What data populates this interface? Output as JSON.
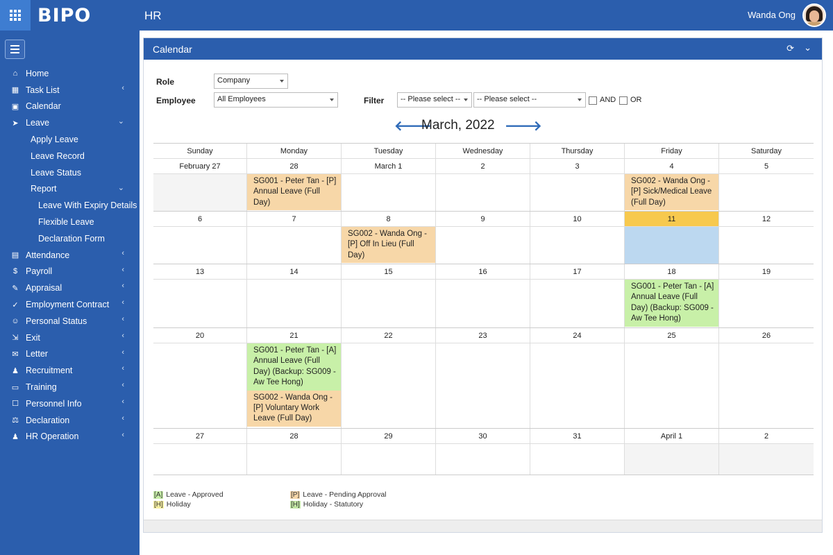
{
  "header": {
    "logo": "BIPO",
    "module": "HR",
    "user_name": "Wanda Ong",
    "colors": {
      "bar": "#2b5ead",
      "apps_button": "#3e7dd1"
    }
  },
  "sidebar": {
    "items": [
      {
        "label": "Home",
        "icon": "home-icon",
        "chevron": ""
      },
      {
        "label": "Task List",
        "icon": "task-list-icon",
        "chevron": "‹"
      },
      {
        "label": "Calendar",
        "icon": "calendar-icon",
        "chevron": ""
      },
      {
        "label": "Leave",
        "icon": "leave-icon",
        "chevron": "⌄"
      },
      {
        "label": "Apply Leave",
        "icon": "",
        "chevron": ""
      },
      {
        "label": "Leave Record",
        "icon": "",
        "chevron": ""
      },
      {
        "label": "Leave Status",
        "icon": "",
        "chevron": ""
      },
      {
        "label": "Report",
        "icon": "",
        "chevron": "⌄"
      },
      {
        "label": "Leave With Expiry Details",
        "icon": "",
        "chevron": ""
      },
      {
        "label": "Flexible Leave",
        "icon": "",
        "chevron": ""
      },
      {
        "label": "Declaration Form",
        "icon": "",
        "chevron": ""
      },
      {
        "label": "Attendance",
        "icon": "attendance-icon",
        "chevron": "‹"
      },
      {
        "label": "Payroll",
        "icon": "payroll-icon",
        "chevron": "‹"
      },
      {
        "label": "Appraisal",
        "icon": "appraisal-icon",
        "chevron": "‹"
      },
      {
        "label": "Employment Contract",
        "icon": "contract-icon",
        "chevron": "‹"
      },
      {
        "label": "Personal Status",
        "icon": "personal-status-icon",
        "chevron": "‹"
      },
      {
        "label": "Exit",
        "icon": "exit-icon",
        "chevron": "‹"
      },
      {
        "label": "Letter",
        "icon": "letter-icon",
        "chevron": "‹"
      },
      {
        "label": "Recruitment",
        "icon": "recruitment-icon",
        "chevron": "‹"
      },
      {
        "label": "Training",
        "icon": "training-icon",
        "chevron": "‹"
      },
      {
        "label": "Personnel Info",
        "icon": "personnel-info-icon",
        "chevron": "‹"
      },
      {
        "label": "Declaration",
        "icon": "declaration-icon",
        "chevron": "‹"
      },
      {
        "label": "HR Operation",
        "icon": "hr-operation-icon",
        "chevron": "‹"
      }
    ]
  },
  "panel": {
    "title": "Calendar"
  },
  "filters": {
    "role_label": "Role",
    "role_value": "Company",
    "employee_label": "Employee",
    "employee_value": "All Employees",
    "filter_label": "Filter",
    "filter1_value": "-- Please select --",
    "filter2_value": "-- Please select --",
    "and_label": "AND",
    "or_label": "OR"
  },
  "calendar": {
    "month_label": "March, 2022",
    "weekdays": [
      "Sunday",
      "Monday",
      "Tuesday",
      "Wednesday",
      "Thursday",
      "Friday",
      "Saturday"
    ],
    "weeks": [
      {
        "days": [
          "February 27",
          "28",
          "March 1",
          "2",
          "3",
          "4",
          "5"
        ],
        "events": [
          [],
          [
            {
              "text": "SG001 - Peter Tan - [P] Annual Leave (Full Day)",
              "status": "pending"
            }
          ],
          [],
          [],
          [],
          [
            {
              "text": "SG002 - Wanda Ong - [P] Sick/Medical Leave (Full Day)",
              "status": "pending"
            }
          ],
          []
        ]
      },
      {
        "days": [
          "6",
          "7",
          "8",
          "9",
          "10",
          "11",
          "12"
        ],
        "events": [
          [],
          [],
          [
            {
              "text": "SG002 - Wanda Ong - [P] Off In Lieu (Full Day)",
              "status": "pending"
            }
          ],
          [],
          [],
          [],
          []
        ]
      },
      {
        "days": [
          "13",
          "14",
          "15",
          "16",
          "17",
          "18",
          "19"
        ],
        "events": [
          [],
          [],
          [],
          [],
          [],
          [
            {
              "text": "SG001 - Peter Tan - [A] Annual Leave (Full Day) (Backup: SG009 - Aw Tee Hong)",
              "status": "approved"
            }
          ],
          []
        ]
      },
      {
        "days": [
          "20",
          "21",
          "22",
          "23",
          "24",
          "25",
          "26"
        ],
        "events": [
          [],
          [
            {
              "text": "SG001 - Peter Tan - [A] Annual Leave (Full Day) (Backup: SG009 - Aw Tee Hong)",
              "status": "approved"
            },
            {
              "text": "SG002 - Wanda Ong - [P] Voluntary Work Leave (Full Day)",
              "status": "pending"
            }
          ],
          [],
          [],
          [],
          [],
          []
        ]
      },
      {
        "days": [
          "27",
          "28",
          "29",
          "30",
          "31",
          "April 1",
          "2"
        ],
        "events": [
          [],
          [],
          [],
          [],
          [],
          [],
          []
        ]
      }
    ],
    "colors": {
      "pending": "#f7d7a8",
      "approved": "#c8f0a8",
      "today_header": "#f7c94e",
      "today_cell": "#bcd8f0"
    }
  },
  "legend": {
    "approved_tag": "[A]",
    "approved_label": "Leave - Approved",
    "pending_tag": "[P]",
    "pending_label": "Leave - Pending Approval",
    "holiday_tag": "[H]",
    "holiday_label": "Holiday",
    "statutory_tag": "[H]",
    "statutory_label": "Holiday - Statutory"
  }
}
